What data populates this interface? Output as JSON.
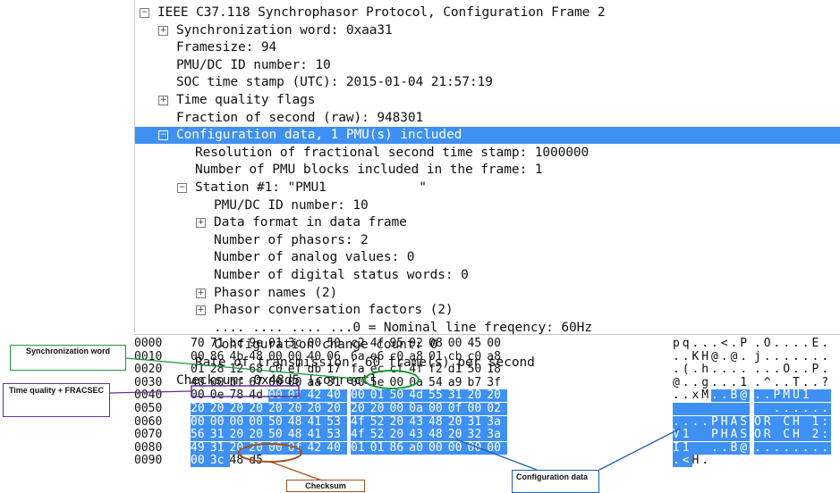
{
  "tree": [
    {
      "indent": 0,
      "expander": "minus",
      "text": "IEEE C37.118 Synchrophasor Protocol, Configuration Frame 2"
    },
    {
      "indent": 1,
      "expander": "plus",
      "text": "Synchronization word: 0xaa31"
    },
    {
      "indent": 1,
      "expander": "",
      "text": "Framesize: 94"
    },
    {
      "indent": 1,
      "expander": "",
      "text": "PMU/DC ID number: 10"
    },
    {
      "indent": 1,
      "expander": "",
      "text": "SOC time stamp (UTC): 2015-01-04 21:57:19"
    },
    {
      "indent": 1,
      "expander": "plus",
      "text": "Time quality flags"
    },
    {
      "indent": 1,
      "expander": "",
      "text": "Fraction of second (raw): 948301"
    },
    {
      "indent": 1,
      "expander": "minus",
      "text": "Configuration data, 1 PMU(s) included",
      "selected": true
    },
    {
      "indent": 2,
      "expander": "",
      "text": "Resolution of fractional second time stamp: 1000000"
    },
    {
      "indent": 2,
      "expander": "",
      "text": "Number of PMU blocks included in the frame: 1"
    },
    {
      "indent": 2,
      "expander": "minus",
      "text": "Station #1: \"PMU1            \""
    },
    {
      "indent": 3,
      "expander": "",
      "text": "PMU/DC ID number: 10"
    },
    {
      "indent": 3,
      "expander": "plus",
      "text": "Data format in data frame"
    },
    {
      "indent": 3,
      "expander": "",
      "text": "Number of phasors: 2"
    },
    {
      "indent": 3,
      "expander": "",
      "text": "Number of analog values: 0"
    },
    {
      "indent": 3,
      "expander": "",
      "text": "Number of digital status words: 0"
    },
    {
      "indent": 3,
      "expander": "plus",
      "text": "Phasor names (2)"
    },
    {
      "indent": 3,
      "expander": "plus",
      "text": "Phasor conversation factors (2)"
    },
    {
      "indent": 3,
      "expander": "",
      "text": ".... .... .... ...0 = Nominal line freqency: 60Hz"
    },
    {
      "indent": 3,
      "expander": "",
      "text": "Configuration change count: 0"
    },
    {
      "indent": 2,
      "expander": "",
      "text": "Rate of transmission: 60 frame(s) per second"
    },
    {
      "indent": 1,
      "expander": "",
      "text": "Checksum: 0x48d5 [correct]"
    }
  ],
  "hex": [
    {
      "offset": "0000",
      "bytes": [
        "70",
        "71",
        "bc",
        "9e",
        "01",
        "3c",
        "00",
        "50",
        "c2",
        "4f",
        "95",
        "92",
        "08",
        "00",
        "45",
        "00"
      ],
      "ascii": [
        "p",
        "q",
        ".",
        ".",
        ".",
        "<",
        ".",
        "P",
        ".",
        "O",
        ".",
        ".",
        ".",
        ".",
        "E",
        "."
      ],
      "hl_from": -1
    },
    {
      "offset": "0010",
      "bytes": [
        "00",
        "86",
        "4b",
        "48",
        "00",
        "00",
        "40",
        "06",
        "6a",
        "e6",
        "c0",
        "a8",
        "01",
        "cb",
        "c0",
        "a8"
      ],
      "ascii": [
        ".",
        ".",
        "K",
        "H",
        "@",
        ".",
        "@",
        ".",
        "j",
        ".",
        ".",
        ".",
        ".",
        ".",
        ".",
        "."
      ],
      "hl_from": -1
    },
    {
      "offset": "0020",
      "bytes": [
        "01",
        "28",
        "12",
        "68",
        "c0",
        "ef",
        "db",
        "17",
        "fa",
        "ec",
        "cf",
        "4f",
        "f2",
        "d1",
        "50",
        "18"
      ],
      "ascii": [
        ".",
        "(",
        ".",
        "h",
        ".",
        ".",
        ".",
        ".",
        ".",
        ".",
        ".",
        "O",
        ".",
        ".",
        "P",
        "."
      ],
      "hl_from": -1
    },
    {
      "offset": "0030",
      "bytes": [
        "40",
        "00",
        "bf",
        "67",
        "00",
        "00",
        "aa",
        "31",
        "00",
        "5e",
        "00",
        "0a",
        "54",
        "a9",
        "b7",
        "3f"
      ],
      "ascii": [
        "@",
        ".",
        ".",
        "g",
        ".",
        ".",
        ".",
        "1",
        ".",
        "^",
        ".",
        ".",
        "T",
        ".",
        ".",
        "?"
      ],
      "hl_from": -1
    },
    {
      "offset": "0040",
      "bytes": [
        "00",
        "0e",
        "78",
        "4d",
        "00",
        "0f",
        "42",
        "40",
        "00",
        "01",
        "50",
        "4d",
        "55",
        "31",
        "20",
        "20"
      ],
      "ascii": [
        ".",
        ".",
        "x",
        "M",
        ".",
        ".",
        "B",
        "@",
        ".",
        ".",
        "P",
        "M",
        "U",
        "1",
        " ",
        " "
      ],
      "hl_from": 4
    },
    {
      "offset": "0050",
      "bytes": [
        "20",
        "20",
        "20",
        "20",
        "20",
        "20",
        "20",
        "20",
        "20",
        "20",
        "00",
        "0a",
        "00",
        "0f",
        "00",
        "02"
      ],
      "ascii": [
        " ",
        " ",
        " ",
        " ",
        " ",
        " ",
        " ",
        " ",
        " ",
        " ",
        ".",
        ".",
        ".",
        ".",
        ".",
        "."
      ],
      "hl_from": 0
    },
    {
      "offset": "0060",
      "bytes": [
        "00",
        "00",
        "00",
        "00",
        "50",
        "48",
        "41",
        "53",
        "4f",
        "52",
        "20",
        "43",
        "48",
        "20",
        "31",
        "3a"
      ],
      "ascii": [
        ".",
        ".",
        ".",
        ".",
        "P",
        "H",
        "A",
        "S",
        "O",
        "R",
        " ",
        "C",
        "H",
        " ",
        "1",
        ":"
      ],
      "hl_from": 0
    },
    {
      "offset": "0070",
      "bytes": [
        "56",
        "31",
        "20",
        "20",
        "50",
        "48",
        "41",
        "53",
        "4f",
        "52",
        "20",
        "43",
        "48",
        "20",
        "32",
        "3a"
      ],
      "ascii": [
        "V",
        "1",
        " ",
        " ",
        "P",
        "H",
        "A",
        "S",
        "O",
        "R",
        " ",
        "C",
        "H",
        " ",
        "2",
        ":"
      ],
      "hl_from": 0
    },
    {
      "offset": "0080",
      "bytes": [
        "49",
        "31",
        "20",
        "20",
        "00",
        "0f",
        "42",
        "40",
        "01",
        "01",
        "86",
        "a0",
        "00",
        "00",
        "00",
        "00"
      ],
      "ascii": [
        "I",
        "1",
        " ",
        " ",
        ".",
        ".",
        "B",
        "@",
        ".",
        ".",
        ".",
        ".",
        ".",
        ".",
        ".",
        "."
      ],
      "hl_from": 0
    },
    {
      "offset": "0090",
      "bytes": [
        "00",
        "3c",
        "48",
        "d5"
      ],
      "ascii": [
        ".",
        "<",
        "H",
        "."
      ],
      "hl_from": 0,
      "hl_to": 2
    }
  ],
  "annotations": {
    "sync_word": "Synchronization word",
    "time_quality": "Time quality + FRACSEC",
    "configuration": "Configuration data",
    "checksum": "Checksum"
  },
  "colors": {
    "selection": "#3e90f2",
    "sync_callout": "#1a9a3a",
    "time_quality_callout": "#6a2f9a",
    "configuration_callout": "#1f5fa8",
    "checksum_callout": "#a0521d"
  }
}
